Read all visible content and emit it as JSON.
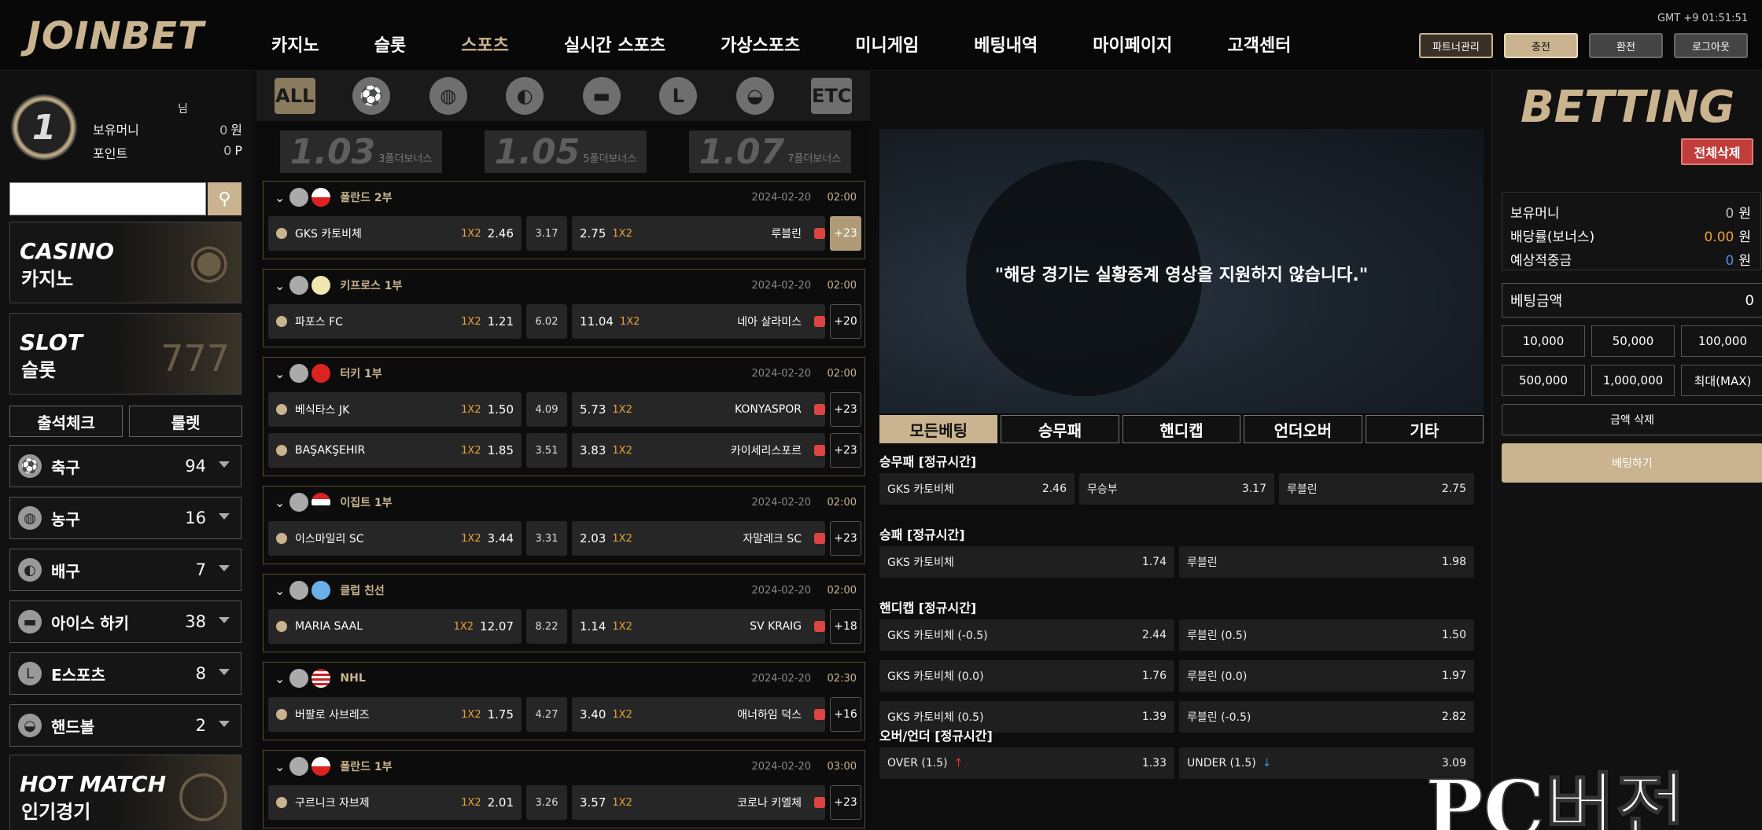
{
  "header": {
    "logo": "JOINBET",
    "nav": [
      "카지노",
      "슬롯",
      "스포츠",
      "실시간 스포츠",
      "가상스포츠",
      "미니게임",
      "베팅내역",
      "마이페이지",
      "고객센터"
    ],
    "active_nav": 2,
    "gmt": "GMT +9 01:51:51",
    "buttons": [
      "파트너관리",
      "충전",
      "환전",
      "로그아웃"
    ]
  },
  "user": {
    "level": "1",
    "name_suffix": "님",
    "money_label": "보유머니",
    "money": "0",
    "money_unit": "원",
    "point_label": "포인트",
    "point": "0",
    "point_unit": "P"
  },
  "search": {
    "placeholder": ""
  },
  "banners": {
    "casino": {
      "en": "CASINO",
      "ko": "카지노"
    },
    "slot": {
      "en": "SLOT",
      "ko": "슬롯"
    },
    "hot": {
      "en": "HOT MATCH",
      "ko": "인기경기"
    }
  },
  "quick": {
    "attendance": "출석체크",
    "roulette": "룰렛"
  },
  "sports": [
    {
      "name": "축구",
      "count": "94",
      "icon": "soccer-ball-icon"
    },
    {
      "name": "농구",
      "count": "16",
      "icon": "basketball-icon"
    },
    {
      "name": "배구",
      "count": "7",
      "icon": "volleyball-icon"
    },
    {
      "name": "아이스 하키",
      "count": "38",
      "icon": "hockey-puck-icon"
    },
    {
      "name": "E스포츠",
      "count": "8",
      "icon": "esports-icon"
    },
    {
      "name": "핸드볼",
      "count": "2",
      "icon": "handball-icon"
    }
  ],
  "sport_tabs": [
    "ALL",
    "soccer",
    "basketball",
    "volleyball",
    "hockey",
    "esports",
    "handball",
    "ETC"
  ],
  "bonuses": [
    {
      "value": "1.03",
      "label": "3폴더보너스"
    },
    {
      "value": "1.05",
      "label": "5폴더보너스"
    },
    {
      "value": "1.07",
      "label": "7폴더보너스"
    }
  ],
  "games": [
    {
      "league": "폴란드 2부",
      "date": "2024-02-20",
      "time": "02:00",
      "rows": [
        {
          "home": "GKS 카토비체",
          "h": "2.46",
          "d": "3.17",
          "a": "2.75",
          "away": "루블린",
          "more": "+23",
          "sel": true
        }
      ]
    },
    {
      "league": "키프로스 1부",
      "date": "2024-02-20",
      "time": "02:00",
      "rows": [
        {
          "home": "파포스 FC",
          "h": "1.21",
          "d": "6.02",
          "a": "11.04",
          "away": "네아 살라미스",
          "more": "+20"
        }
      ]
    },
    {
      "league": "터키 1부",
      "date": "2024-02-20",
      "time": "02:00",
      "rows": [
        {
          "home": "베식타스 JK",
          "h": "1.50",
          "d": "4.09",
          "a": "5.73",
          "away": "KONYASPOR",
          "more": "+23"
        },
        {
          "home": "BAŞAKŞEHIR",
          "h": "1.85",
          "d": "3.51",
          "a": "3.83",
          "away": "카이세리스포르",
          "more": "+23"
        }
      ]
    },
    {
      "league": "이집트 1부",
      "date": "2024-02-20",
      "time": "02:00",
      "rows": [
        {
          "home": "이스마일리 SC",
          "h": "3.44",
          "d": "3.31",
          "a": "2.03",
          "away": "자말레크 SC",
          "more": "+23"
        }
      ]
    },
    {
      "league": "클럽 친선",
      "date": "2024-02-20",
      "time": "02:00",
      "rows": [
        {
          "home": "MARIA SAAL",
          "h": "12.07",
          "d": "8.22",
          "a": "1.14",
          "away": "SV KRAIG",
          "more": "+18"
        }
      ]
    },
    {
      "league": "NHL",
      "date": "2024-02-20",
      "time": "02:30",
      "rows": [
        {
          "home": "버팔로 사브레즈",
          "h": "1.75",
          "d": "4.27",
          "a": "3.40",
          "away": "애너하임 덕스",
          "more": "+16"
        }
      ]
    },
    {
      "league": "폴란드 1부",
      "date": "2024-02-20",
      "time": "03:00",
      "rows": [
        {
          "home": "구르니크 자브제",
          "h": "2.01",
          "d": "3.26",
          "a": "3.57",
          "away": "코로나 키엘체",
          "more": "+23"
        }
      ]
    }
  ],
  "market": "1X2",
  "detail": {
    "video_msg": "\"해당 경기는 실황중계 영상을 지원하지 않습니다.\"",
    "tabs": [
      "모든베팅",
      "승무패",
      "핸디캡",
      "언더오버",
      "기타"
    ],
    "sections": [
      {
        "title": "승무패 [정규시간]",
        "rows": [
          [
            {
              "n": "GKS 카토비체",
              "o": "2.46"
            },
            {
              "n": "무승부",
              "o": "3.17"
            },
            {
              "n": "루블린",
              "o": "2.75"
            }
          ]
        ]
      },
      {
        "title": "승패 [정규시간]",
        "rows": [
          [
            {
              "n": "GKS 카토비체",
              "o": "1.74"
            },
            {
              "n": "루블린",
              "o": "1.98"
            }
          ]
        ]
      },
      {
        "title": "핸디캡 [정규시간]",
        "rows": [
          [
            {
              "n": "GKS 카토비체 (-0.5)",
              "o": "2.44"
            },
            {
              "n": "루블린 (0.5)",
              "o": "1.50"
            }
          ],
          [
            {
              "n": "GKS 카토비체 (0.0)",
              "o": "1.76"
            },
            {
              "n": "루블린 (0.0)",
              "o": "1.97"
            }
          ],
          [
            {
              "n": "GKS 카토비체 (0.5)",
              "o": "1.39"
            },
            {
              "n": "루블린 (-0.5)",
              "o": "2.82"
            }
          ]
        ]
      },
      {
        "title": "오버/언더 [정규시간]",
        "rows": [
          [
            {
              "n": "OVER (1.5)",
              "o": "1.33"
            },
            {
              "n": "UNDER (1.5)",
              "o": "3.09"
            }
          ]
        ]
      }
    ]
  },
  "betslip": {
    "title": "BETTING",
    "clear_all": "전체삭제",
    "money_label": "보유머니",
    "money": "0",
    "rate_label": "배당률(보너스)",
    "rate": "0.00",
    "expected_label": "예상적중금",
    "expected": "0",
    "unit": "원",
    "amount_label": "베팅금액",
    "amount": "0",
    "quick": [
      "10,000",
      "50,000",
      "100,000",
      "500,000",
      "1,000,000",
      "최대(MAX)"
    ],
    "clear_amount": "금액 삭제",
    "bet": "베팅하기",
    "colors": {
      "accent": "#c9b48f",
      "rate": "#e8a23b",
      "expected": "#4a8fe0"
    }
  },
  "watermark": "PC버전"
}
